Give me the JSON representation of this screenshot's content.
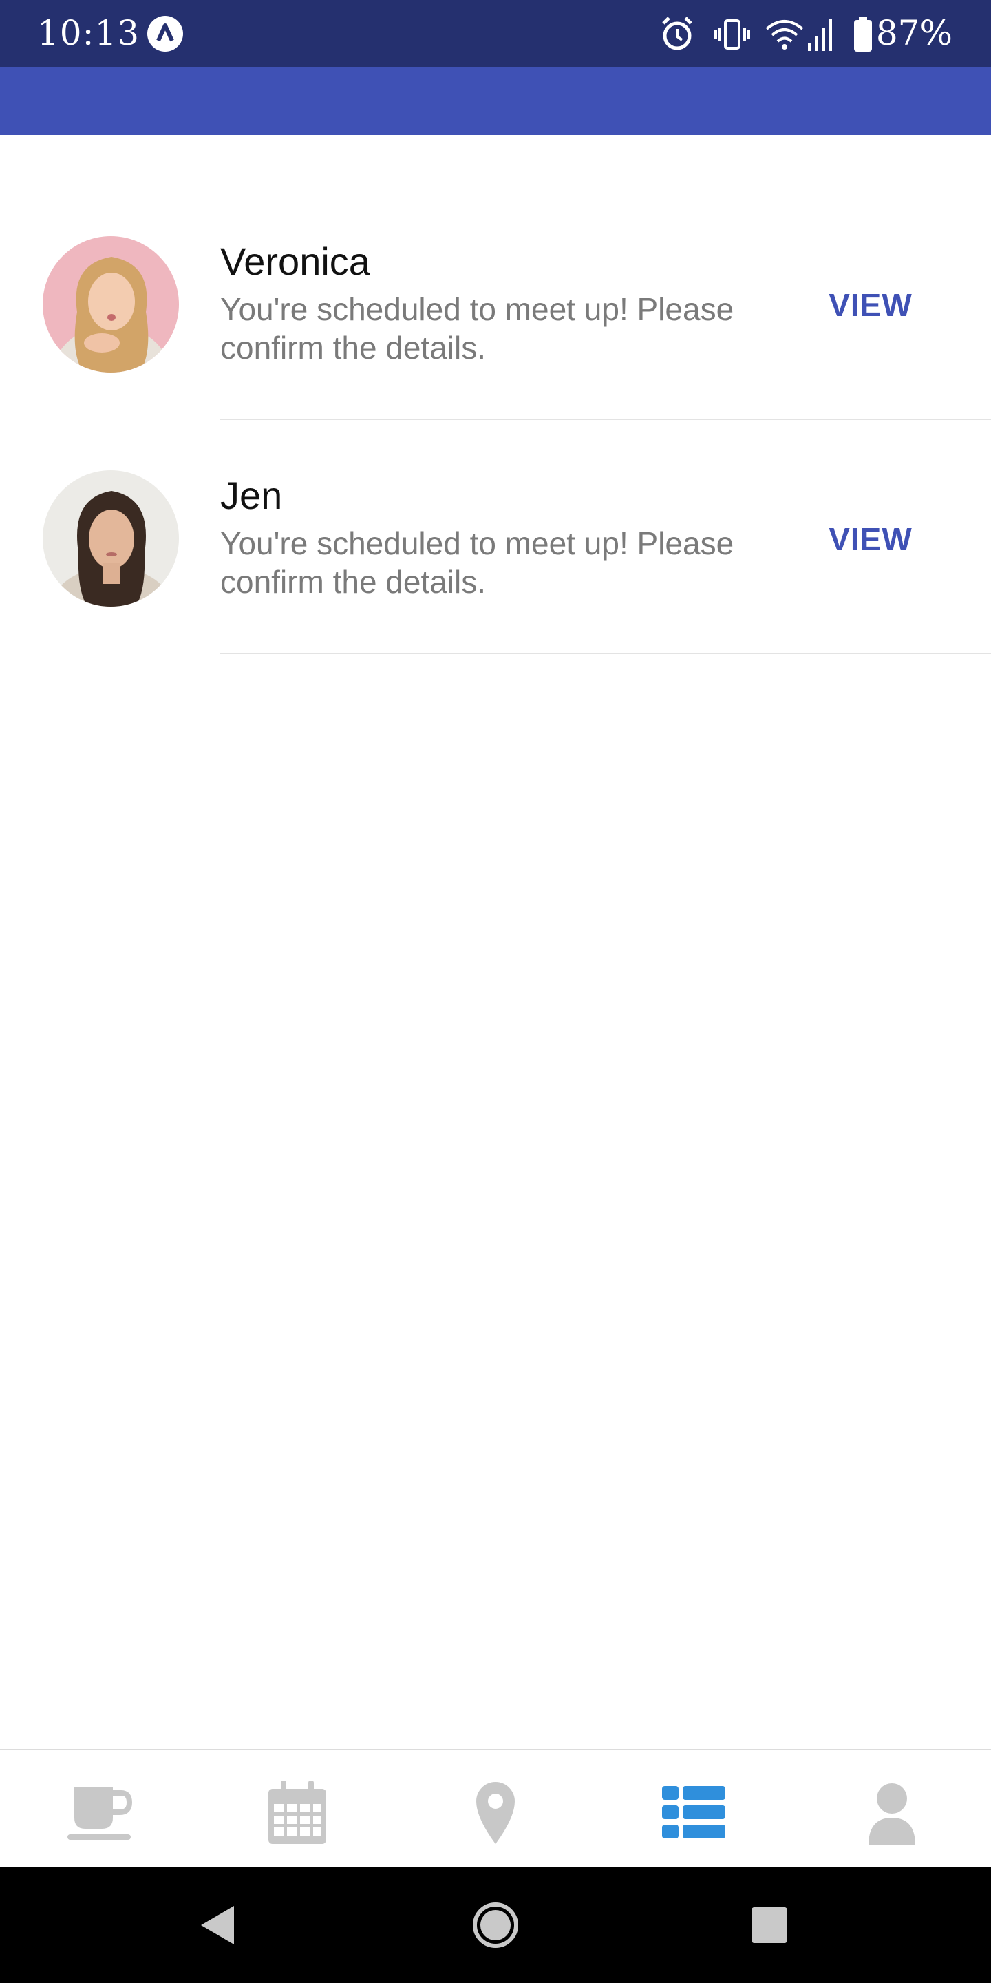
{
  "status_bar": {
    "time": "10:13",
    "battery": "87%",
    "icons": [
      "app-notification-icon",
      "alarm-icon",
      "vibrate-icon",
      "wifi-icon",
      "signal-icon",
      "battery-icon"
    ]
  },
  "conversations": [
    {
      "name": "Veronica",
      "message": "You're scheduled to meet up! Please confirm the details.",
      "action": "VIEW"
    },
    {
      "name": "Jen",
      "message": "You're scheduled to meet up! Please confirm the details.",
      "action": "VIEW"
    }
  ],
  "bottom_nav": {
    "items": [
      {
        "icon": "coffee-icon",
        "active": false
      },
      {
        "icon": "calendar-icon",
        "active": false
      },
      {
        "icon": "location-pin-icon",
        "active": false
      },
      {
        "icon": "list-icon",
        "active": true
      },
      {
        "icon": "profile-icon",
        "active": false
      }
    ]
  },
  "colors": {
    "status_bar": "#25306f",
    "app_bar": "#3f51b5",
    "accent": "#3f51b5",
    "nav_active": "#2f8fdc",
    "nav_inactive": "#c8c8c8"
  },
  "system_nav": [
    "back-icon",
    "home-icon",
    "recents-icon"
  ]
}
